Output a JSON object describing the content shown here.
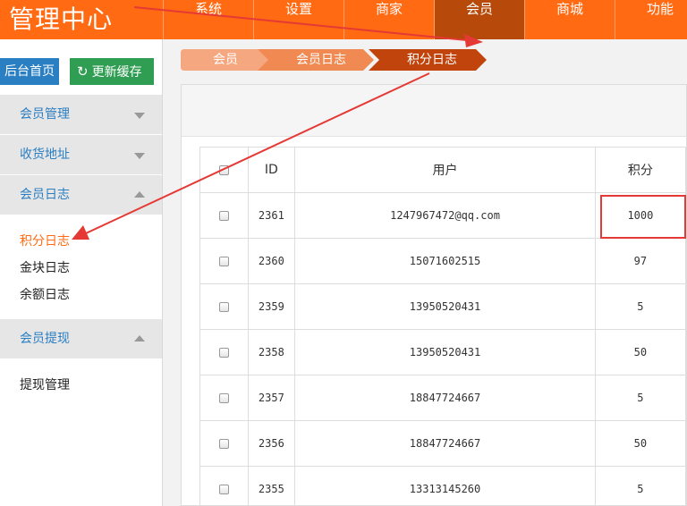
{
  "header": {
    "brand": "管理中心",
    "nav": [
      "系统",
      "设置",
      "商家",
      "会员",
      "商城",
      "功能"
    ],
    "active_index": 3
  },
  "sidebar": {
    "home_button": "后台首页",
    "cache_button": "更新缓存",
    "groups": [
      {
        "label": "会员管理",
        "expanded": false,
        "items": []
      },
      {
        "label": "收货地址",
        "expanded": false,
        "items": []
      },
      {
        "label": "会员日志",
        "expanded": true,
        "items": [
          "积分日志",
          "金块日志",
          "余额日志"
        ],
        "active_item": "积分日志"
      },
      {
        "label": "会员提现",
        "expanded": true,
        "items": [
          "提现管理"
        ]
      }
    ]
  },
  "breadcrumb": [
    "会员",
    "会员日志",
    "积分日志"
  ],
  "table": {
    "headers": [
      "ID",
      "用户",
      "积分"
    ],
    "rows": [
      {
        "id": "2361",
        "user": "1247967472@qq.com",
        "points": "1000"
      },
      {
        "id": "2360",
        "user": "15071602515",
        "points": "97"
      },
      {
        "id": "2359",
        "user": "13950520431",
        "points": "5"
      },
      {
        "id": "2358",
        "user": "13950520431",
        "points": "50"
      },
      {
        "id": "2357",
        "user": "18847724667",
        "points": "5"
      },
      {
        "id": "2356",
        "user": "18847724667",
        "points": "50"
      },
      {
        "id": "2355",
        "user": "13313145260",
        "points": "5"
      }
    ]
  },
  "colors": {
    "header": "#ff6a13",
    "nav_active": "#b74a0b",
    "link": "#2a7ec2",
    "cache_button": "#2f9d52",
    "annotation": "#e53935"
  }
}
